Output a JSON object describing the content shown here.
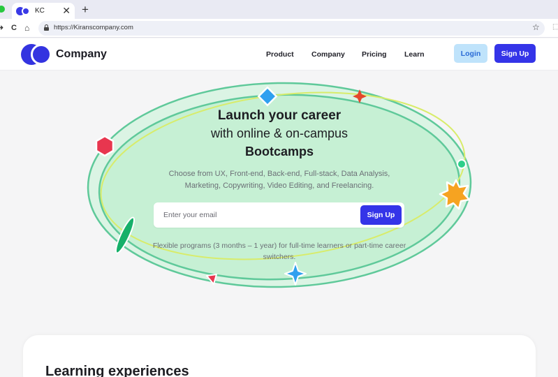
{
  "browser": {
    "tab_title": "KC",
    "tab_close": "✕",
    "new_tab": "+",
    "url": "https://Kiranscompany.com",
    "nav_back": "➜",
    "nav_reload": "C",
    "nav_home": "⌂",
    "star": "☆"
  },
  "header": {
    "brand": "Company",
    "nav": [
      "Product",
      "Company",
      "Pricing",
      "Learn"
    ],
    "login_label": "Login",
    "signup_label": "Sign Up"
  },
  "hero": {
    "title_line1": "Launch your career",
    "title_line2": "with online & on-campus",
    "title_line3": "Bootcamps",
    "subtitle": "Choose from UX, Front-end, Back-end, Full-stack, Data Analysis, Marketing, Copywriting, Video Editing, and Freelancing.",
    "email_placeholder": "Enter your email",
    "signup_label": "Sign Up",
    "note": "Flexible programs (3 months – 1 year) for full-time learners or part-time career switchers."
  },
  "section": {
    "title": "Learning experiences"
  },
  "colors": {
    "primary": "#3434e8",
    "login_bg": "#bfe3fb",
    "ellipse_fill": "#c6f0d4",
    "ellipse_stroke": "#5fc99a",
    "ellipse_yellow": "#d8ec6a"
  }
}
